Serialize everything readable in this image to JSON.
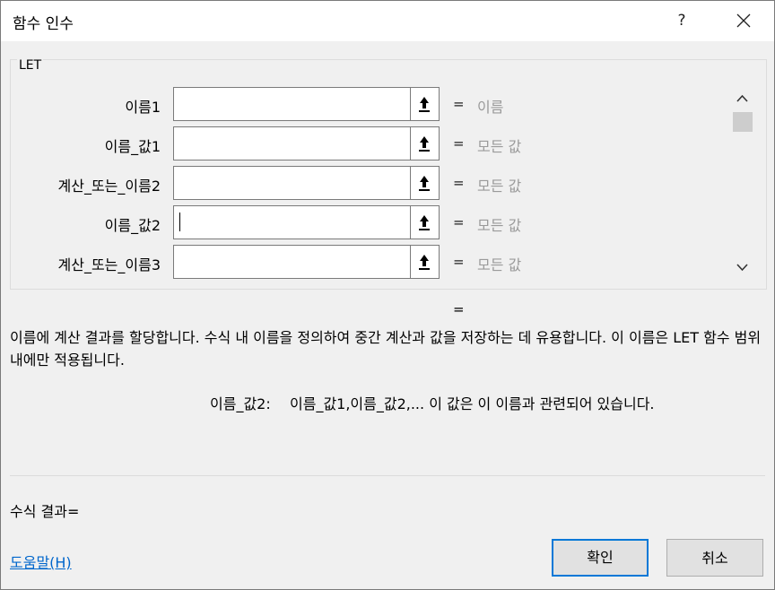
{
  "window": {
    "title": "함수 인수",
    "help_label": "?"
  },
  "group": {
    "label": "LET"
  },
  "arguments": [
    {
      "label": "이름1",
      "value": "",
      "result": "이름"
    },
    {
      "label": "이름_값1",
      "value": "",
      "result": "모든 값"
    },
    {
      "label": "계산_또는_이름2",
      "value": "",
      "result": "모든 값"
    },
    {
      "label": "이름_값2",
      "value": "",
      "result": "모든 값"
    },
    {
      "label": "계산_또는_이름3",
      "value": "",
      "result": "모든 값"
    }
  ],
  "equals_sign": "=",
  "description": "이름에 계산 결과를 할당합니다. 수식 내 이름을 정의하여 중간 계산과 값을 저장하는 데 유용합니다. 이 이름은 LET 함수 범위 내에만 적용됩니다.",
  "argument_help": {
    "name": "이름_값2:",
    "text": "이름_값1,이름_값2,... 이 값은 이 이름과 관련되어 있습니다."
  },
  "formula_result": "수식 결과=",
  "help_link": "도움말(H)",
  "buttons": {
    "ok": "확인",
    "cancel": "취소"
  },
  "colors": {
    "accent": "#0078d7",
    "link": "#0066cc",
    "hint": "#9a9a9a"
  }
}
